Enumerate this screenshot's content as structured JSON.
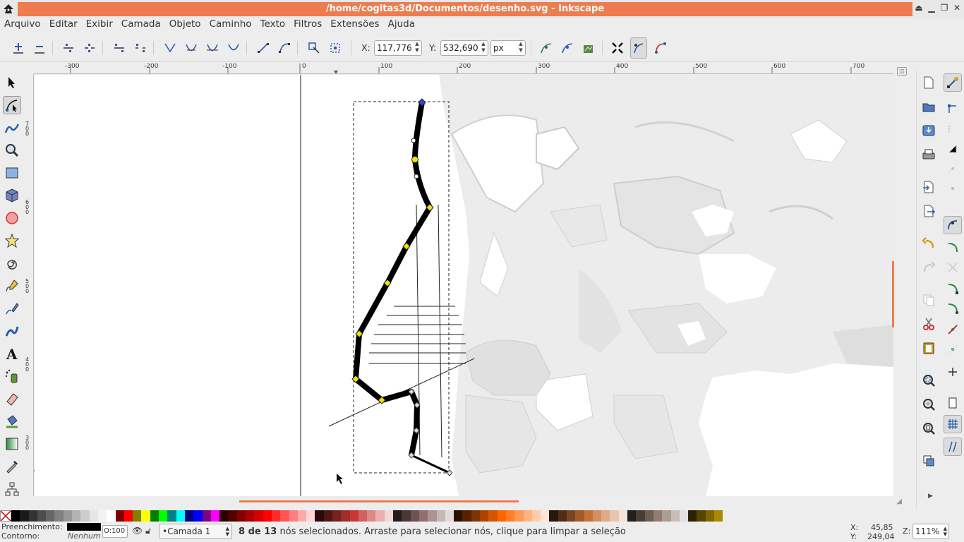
{
  "window": {
    "title": "/home/cogitas3d/Documentos/desenho.svg - Inkscape"
  },
  "menu": [
    "Arquivo",
    "Editar",
    "Exibir",
    "Camada",
    "Objeto",
    "Caminho",
    "Texto",
    "Filtros",
    "Extensões",
    "Ajuda"
  ],
  "toolbar": {
    "x_label": "X:",
    "x_value": "117,776",
    "y_label": "Y:",
    "y_value": "532,690",
    "unit": "px"
  },
  "ruler": {
    "h_labels": [
      "-300",
      "-200",
      "-100",
      "0",
      "100",
      "200",
      "300",
      "400",
      "500",
      "600",
      "700"
    ],
    "v_labels": [
      "700",
      "600",
      "500",
      "400",
      "300"
    ]
  },
  "status": {
    "fill_label": "Preenchimento:",
    "stroke_label": "Contorno:",
    "stroke_value": "Nenhum",
    "opacity_value": "O:100",
    "layer": "•Camada 1",
    "message_bold": "8 de 13",
    "message": " nós selecionados. Arraste para selecionar nós, clique para limpar a seleção",
    "x_label": "X:",
    "x_value": "45,85",
    "y_label": "Y:",
    "y_value": "249,04",
    "zoom_label": "Z:",
    "zoom_value": "111%"
  },
  "palette": [
    "#000000",
    "#1a1a1a",
    "#333333",
    "#4d4d4d",
    "#666666",
    "#808080",
    "#999999",
    "#b3b3b3",
    "#cccccc",
    "#e6e6e6",
    "#f2f2f2",
    "#ffffff",
    "#800000",
    "#ff0000",
    "#808000",
    "#ffff00",
    "#008000",
    "#00ff00",
    "#008080",
    "#00ffff",
    "#000080",
    "#0000ff",
    "#800080",
    "#ff00ff",
    "#2b0000",
    "#550000",
    "#800000",
    "#aa0000",
    "#d40000",
    "#ff0000",
    "#ff2a2a",
    "#ff5555",
    "#ff8080",
    "#ffaaaa",
    "#ffd5d5",
    "#280b0b",
    "#501616",
    "#782121",
    "#a02c2c",
    "#c83737",
    "#d35f5f",
    "#de8787",
    "#e9afaf",
    "#f4d7d7",
    "#241c1c",
    "#483737",
    "#6c5353",
    "#916f6f",
    "#ac9393",
    "#c8b7b7",
    "#e3dbdb",
    "#2b1100",
    "#552200",
    "#803300",
    "#aa4400",
    "#d45500",
    "#ff6600",
    "#ff7f2a",
    "#ff9955",
    "#ffb380",
    "#ffccaa",
    "#ffe6d5",
    "#28170b",
    "#502d16",
    "#784421",
    "#a05a2c",
    "#c87137",
    "#d38d5f",
    "#deaa87",
    "#e9c6af",
    "#f4e3d7",
    "#241f1c",
    "#483e37",
    "#6c5d53",
    "#917c6f",
    "#ac9d93",
    "#c8beb7",
    "#e3dedb",
    "#2b2200",
    "#554400",
    "#806600",
    "#aa8800"
  ]
}
